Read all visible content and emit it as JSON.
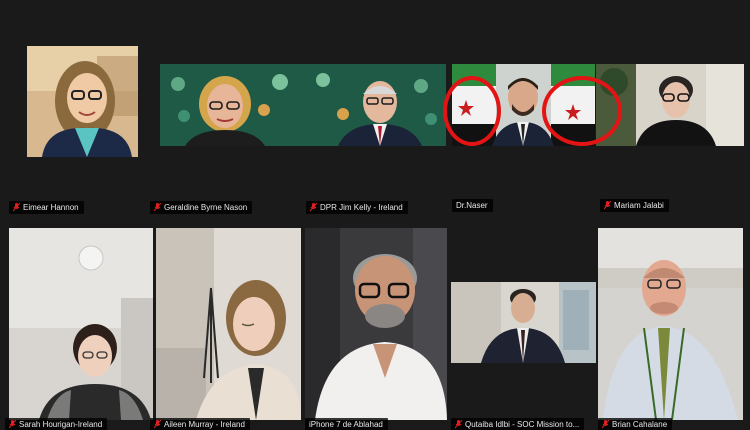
{
  "participants": [
    {
      "name": "Eimear Hannon",
      "muted": true
    },
    {
      "name": "Geraldine Byrne Nason",
      "muted": true
    },
    {
      "name": "DPR Jim Kelly - Ireland",
      "muted": true
    },
    {
      "name": "Dr.Naser",
      "muted": false
    },
    {
      "name": "Mariam Jalabi",
      "muted": true
    },
    {
      "name": "Sarah Hourigan-Ireland",
      "muted": true
    },
    {
      "name": "Aileen Murray - Ireland",
      "muted": true
    },
    {
      "name": "iPhone 7 de Ablahad",
      "muted": false
    },
    {
      "name": "Qutaiba Idlbi - SOC Mission to...",
      "muted": true
    },
    {
      "name": "Brian Cahalane",
      "muted": true
    }
  ],
  "colors": {
    "background": "#1a1a1a",
    "annotation_circle": "#e21414",
    "muted_icon": "#e02020"
  },
  "icons": {
    "muted": "mic-muted-icon"
  }
}
